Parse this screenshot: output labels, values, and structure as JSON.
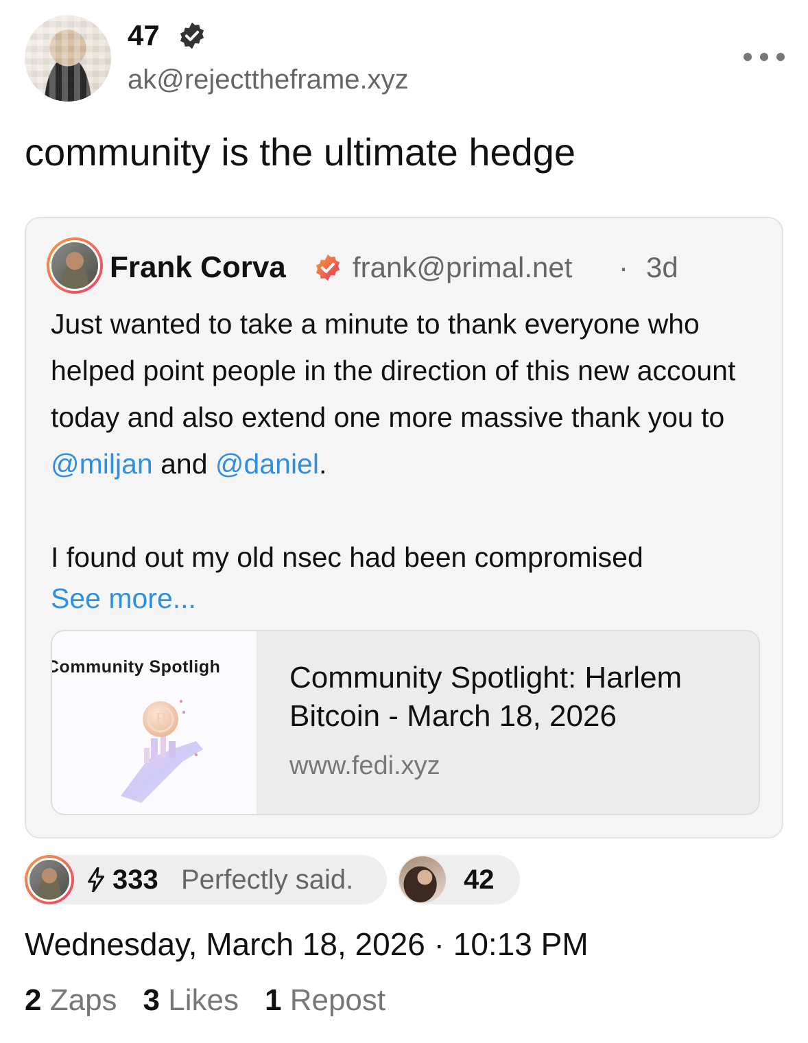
{
  "post": {
    "author_name": "47",
    "author_handle": "ak@rejecttheframe.xyz",
    "text": "community is the ultimate hedge",
    "timestamp": "Wednesday, March 18, 2026 · 10:13 PM"
  },
  "quote": {
    "author_name": "Frank Corva",
    "author_handle": "frank@primal.net",
    "separator": "·",
    "time_ago": "3d",
    "body_text": "Just wanted to take a minute to thank everyone who helped point people in the direction of this new account today and also extend one more massive thank you to ",
    "mention_1": "@miljan",
    "and_text": " and ",
    "mention_2": "@daniel",
    "period": ".",
    "body_text_2": "I found out my old nsec had been compromised",
    "see_more": "See more...",
    "link_preview": {
      "thumb_text": "Community Spotligh",
      "title": "Community Spotlight: Harlem Bitcoin - March 18, 2026",
      "url": "www.fedi.xyz"
    }
  },
  "top_zap": {
    "amount": "333",
    "comment": "Perfectly said."
  },
  "likes": {
    "count": "42"
  },
  "stats": {
    "zaps_count": "2",
    "zaps_label": "Zaps",
    "likes_count": "3",
    "likes_label": "Likes",
    "reposts_count": "1",
    "reposts_label": "Repost"
  },
  "colors": {
    "mention": "#2f8fe0",
    "verified_badge_author": "#333333",
    "verified_badge_quote": "#ec4a3b",
    "muted_text": "#666666"
  },
  "icons": [
    "verified-badge-icon",
    "more-options-icon",
    "lightning-bolt-icon",
    "bitcoin-map-illustration"
  ]
}
